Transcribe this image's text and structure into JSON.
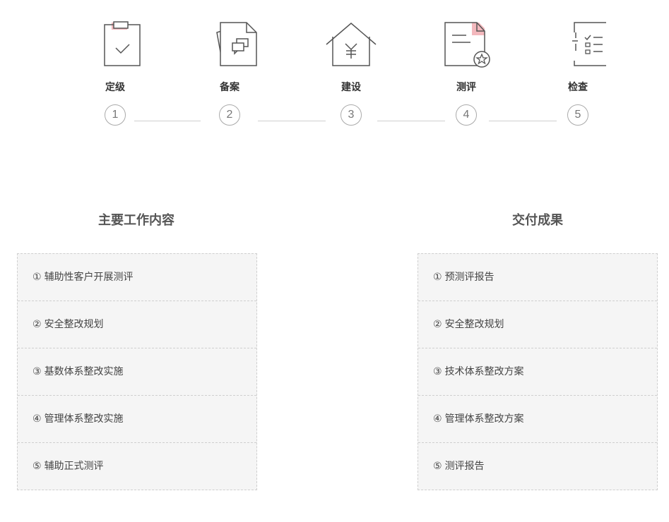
{
  "steps": [
    {
      "label": "定级",
      "number": "1",
      "icon": "clipboard-check-icon"
    },
    {
      "label": "备案",
      "number": "2",
      "icon": "document-chat-icon"
    },
    {
      "label": "建设",
      "number": "3",
      "icon": "house-yuan-icon"
    },
    {
      "label": "测评",
      "number": "4",
      "icon": "document-star-icon"
    },
    {
      "label": "检查",
      "number": "5",
      "icon": "checklist-icon"
    }
  ],
  "colors": {
    "accent": "#f3b8bd",
    "line": "#555555"
  },
  "main_work": {
    "title": "主要工作内容",
    "items": [
      {
        "marker": "①",
        "text": "辅助性客户开展测评"
      },
      {
        "marker": "②",
        "text": "安全整改规划"
      },
      {
        "marker": "③",
        "text": "基数体系整改实施"
      },
      {
        "marker": "④",
        "text": "管理体系整改实施"
      },
      {
        "marker": "⑤",
        "text": "辅助正式测评"
      }
    ]
  },
  "deliverables": {
    "title": "交付成果",
    "items": [
      {
        "marker": "①",
        "text": "预测评报告"
      },
      {
        "marker": "②",
        "text": "安全整改规划"
      },
      {
        "marker": "③",
        "text": "技术体系整改方案"
      },
      {
        "marker": "④",
        "text": "管理体系整改方案"
      },
      {
        "marker": "⑤",
        "text": "测评报告"
      }
    ]
  }
}
